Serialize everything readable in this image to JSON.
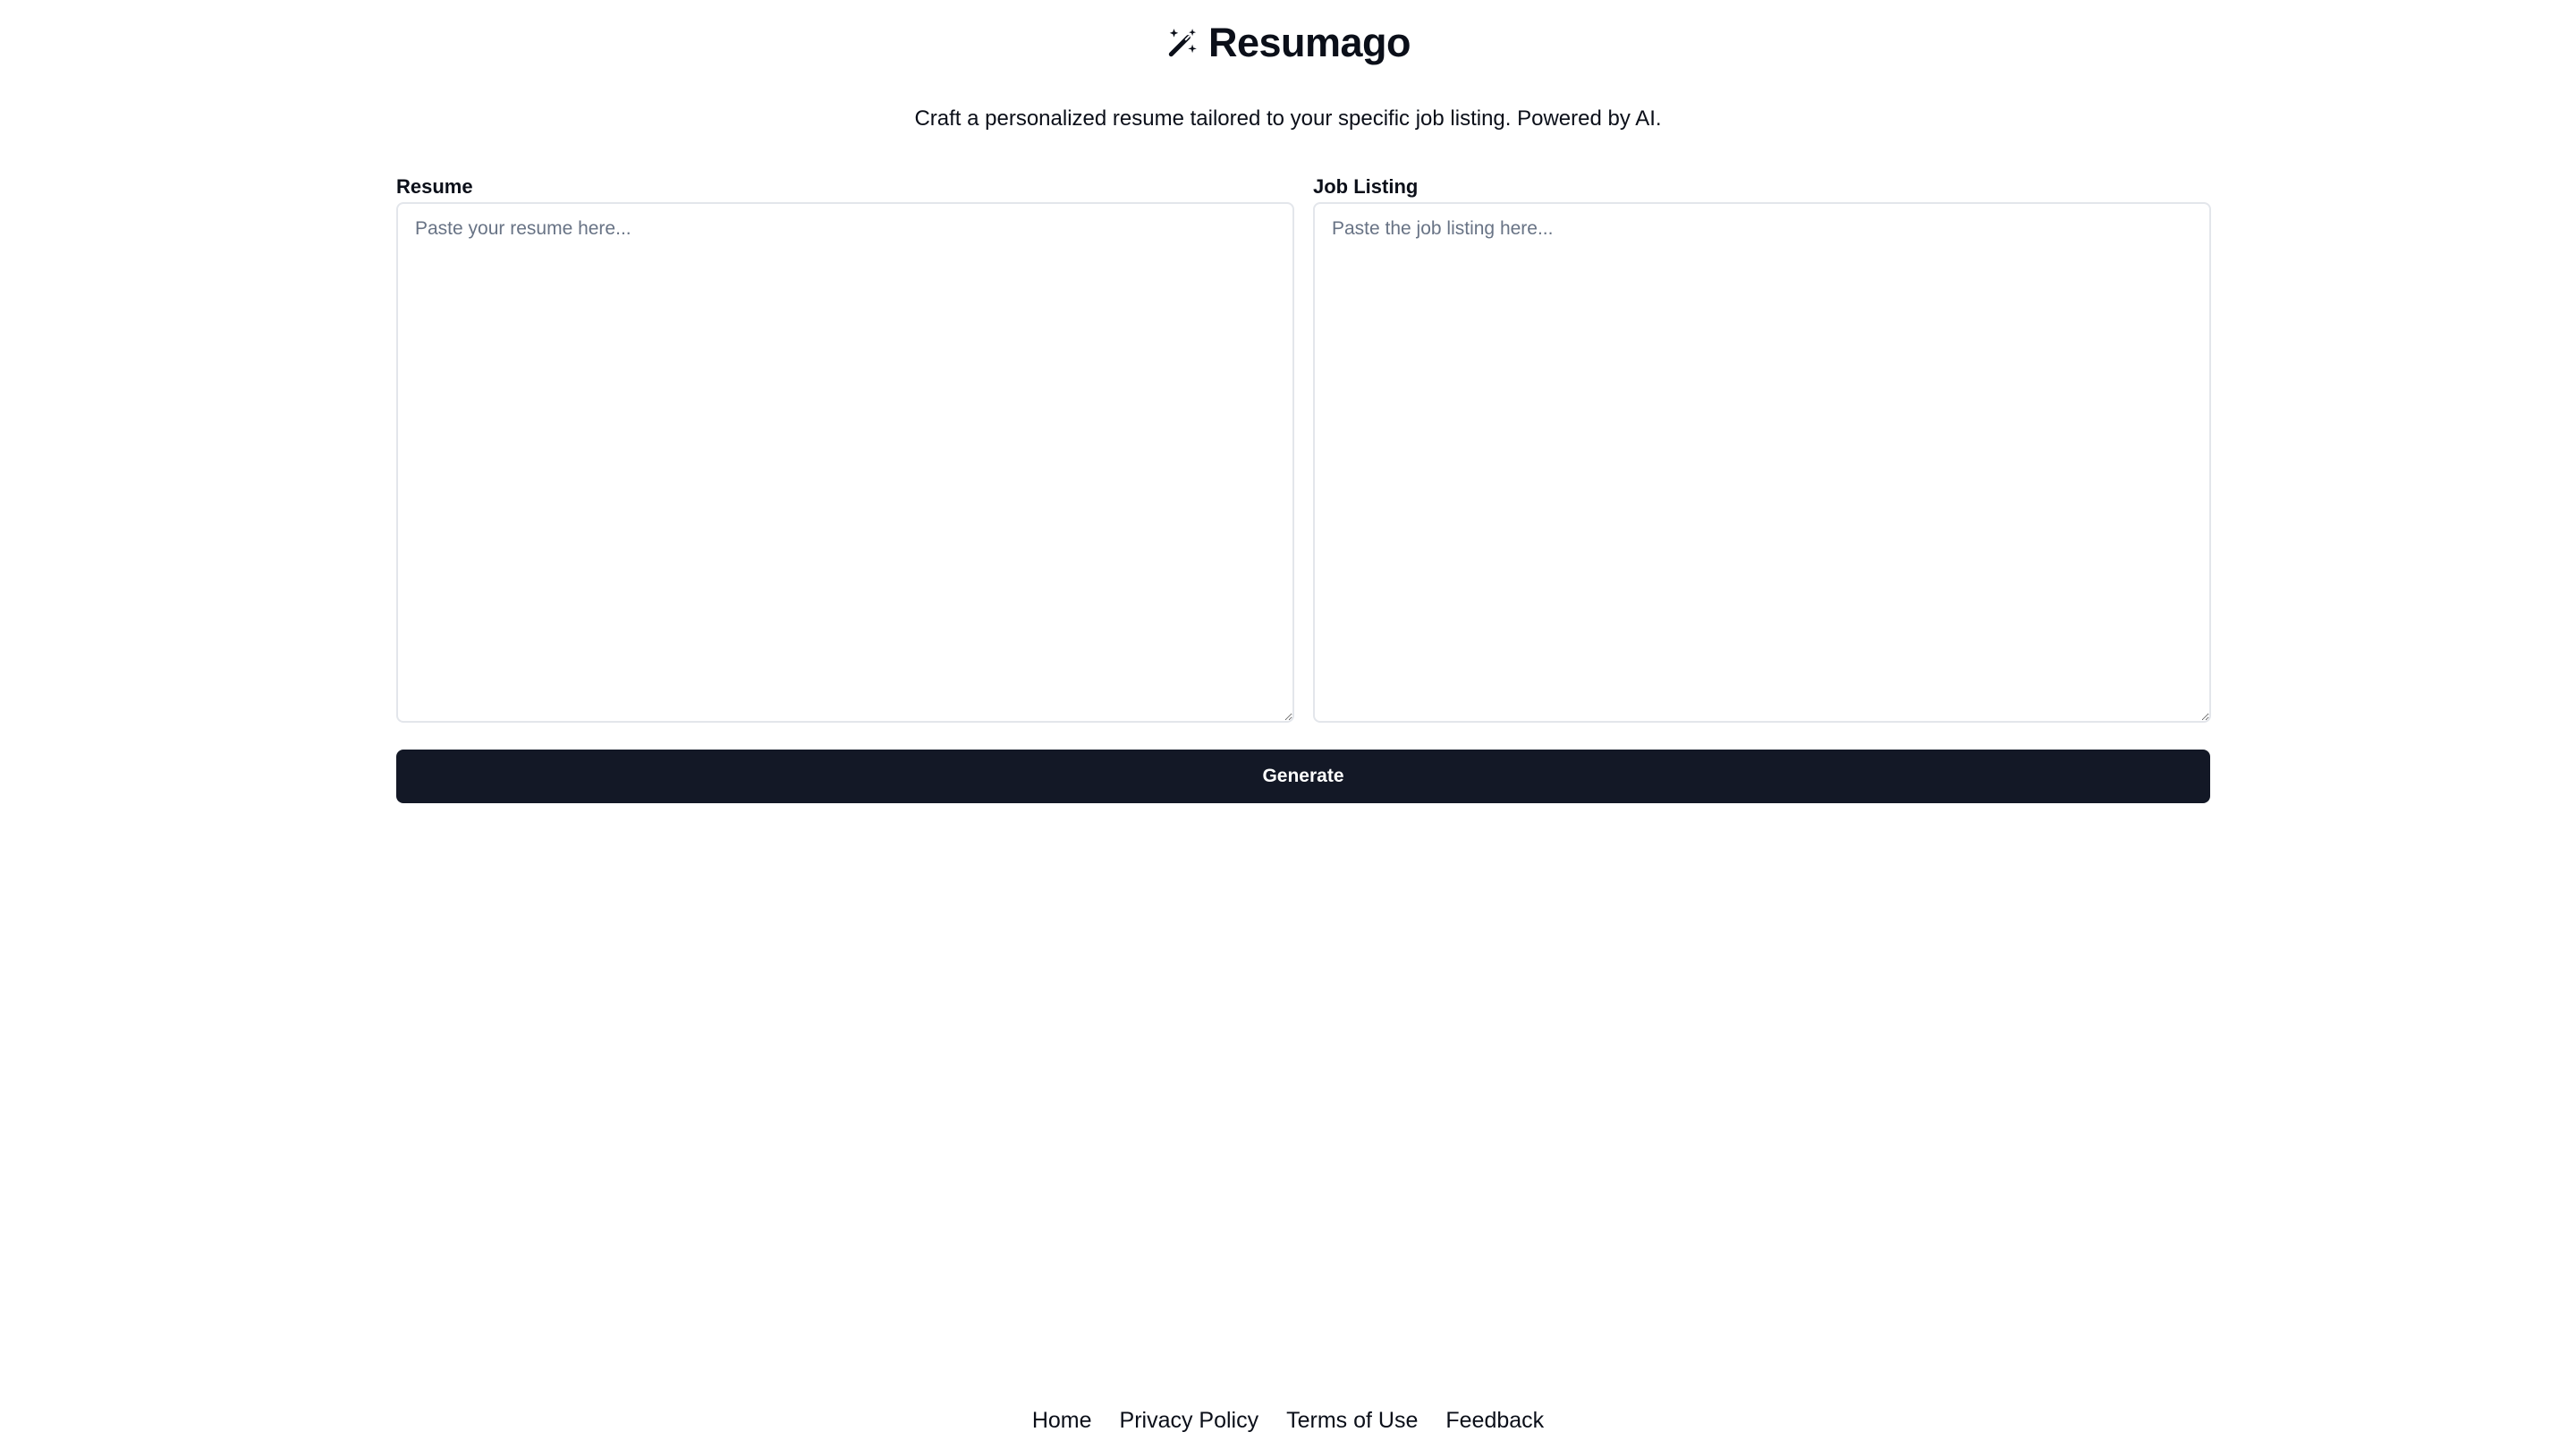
{
  "header": {
    "app_name": "Resumago",
    "logo_icon": "magic-wand-sparkle-icon",
    "tagline": "Craft a personalized resume tailored to your specific job listing. Powered by AI."
  },
  "form": {
    "resume": {
      "label": "Resume",
      "placeholder": "Paste your resume here...",
      "value": ""
    },
    "job_listing": {
      "label": "Job Listing",
      "placeholder": "Paste the job listing here...",
      "value": ""
    },
    "generate_label": "Generate"
  },
  "footer": {
    "links": [
      "Home",
      "Privacy Policy",
      "Terms of Use",
      "Feedback"
    ]
  },
  "colors": {
    "primary_button": "#131826",
    "text": "#0b0f19",
    "border": "#e3e6eb",
    "placeholder": "#687385"
  }
}
